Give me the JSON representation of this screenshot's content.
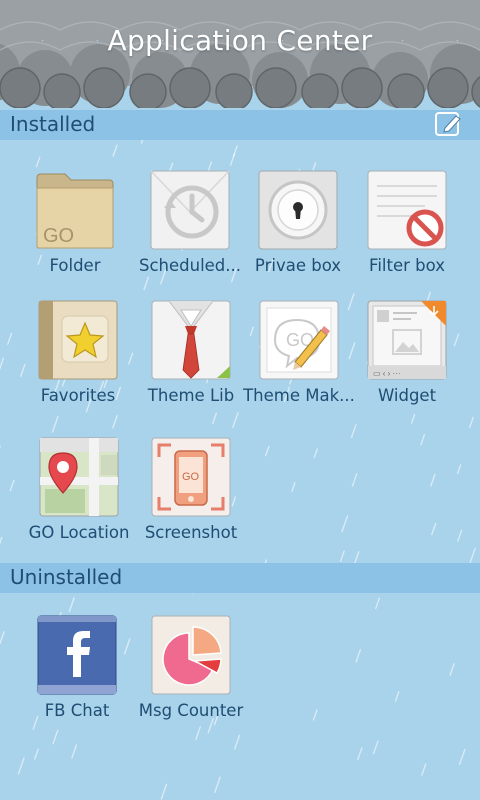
{
  "header": {
    "title": "Application Center"
  },
  "installed": {
    "label": "Installed",
    "edit_icon": "edit-icon",
    "apps": [
      {
        "label": "Folder",
        "icon": "folder-icon"
      },
      {
        "label": "Scheduled...",
        "icon": "clock-icon"
      },
      {
        "label": "Privae box",
        "icon": "lock-icon"
      },
      {
        "label": "Filter box",
        "icon": "filter-icon"
      },
      {
        "label": "Favorites",
        "icon": "star-icon"
      },
      {
        "label": "Theme Lib",
        "icon": "tie-icon"
      },
      {
        "label": "Theme Mak...",
        "icon": "pencil-icon"
      },
      {
        "label": "Widget",
        "icon": "widget-icon"
      },
      {
        "label": "GO Location",
        "icon": "map-pin-icon"
      },
      {
        "label": "Screenshot",
        "icon": "phone-icon"
      }
    ]
  },
  "uninstalled": {
    "label": "Uninstalled",
    "apps": [
      {
        "label": "FB Chat",
        "icon": "facebook-icon"
      },
      {
        "label": "Msg Counter",
        "icon": "pie-chart-icon"
      }
    ]
  },
  "colors": {
    "background": "#a9d3ea",
    "section_bar": "#8cc2e5",
    "text": "#1f4d73",
    "cloud_dark": "#7d8488"
  }
}
